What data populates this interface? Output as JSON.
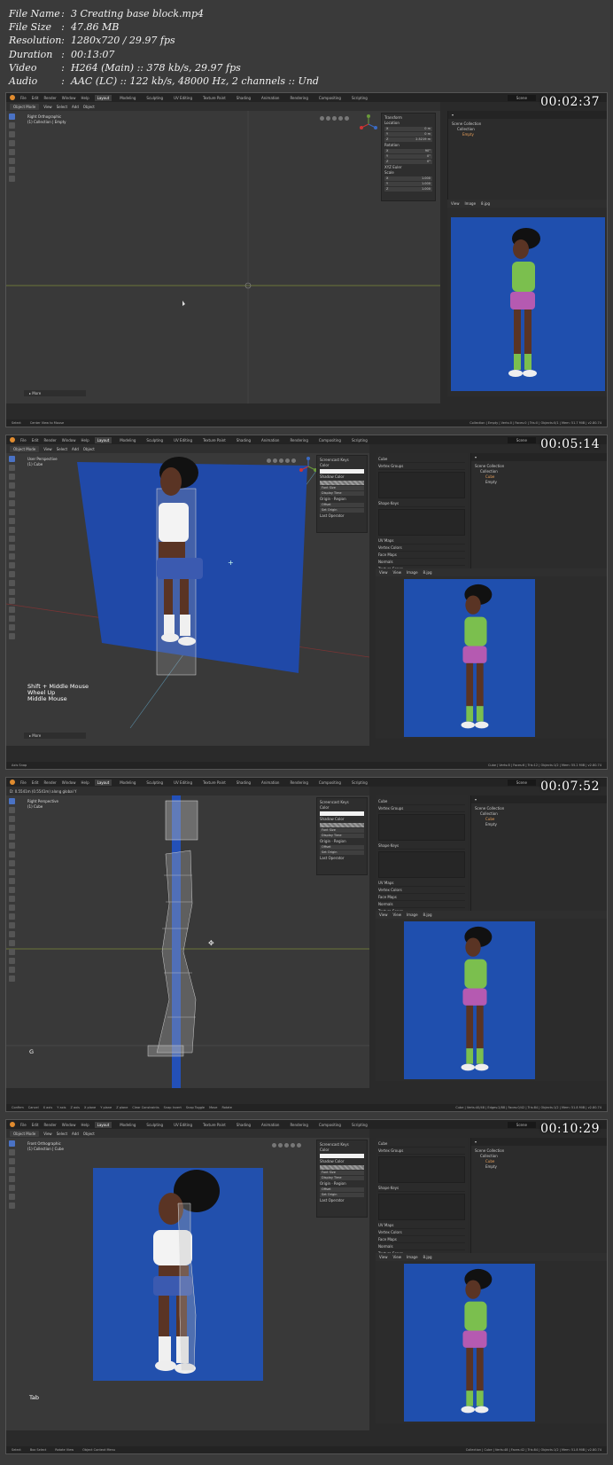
{
  "meta": [
    {
      "key": "File Name",
      "value": "3 Creating base block.mp4"
    },
    {
      "key": "File Size",
      "value": "47.86 MB"
    },
    {
      "key": "Resolution",
      "value": "1280x720 / 29.97 fps"
    },
    {
      "key": "Duration",
      "value": "00:13:07"
    },
    {
      "key": "Video",
      "value": "H264 (Main) :: 378 kb/s, 29.97 fps"
    },
    {
      "key": "Audio",
      "value": "AAC (LC) :: 122 kb/s, 48000 Hz, 2 channels :: Und"
    }
  ],
  "ui": {
    "menus": [
      "File",
      "Edit",
      "Render",
      "Window",
      "Help"
    ],
    "workspaces": [
      "Layout",
      "Modeling",
      "Sculpting",
      "UV Editing",
      "Texture Paint",
      "Shading",
      "Animation",
      "Rendering",
      "Compositing",
      "Scripting"
    ],
    "scene": "Scene",
    "view_menus": [
      "View",
      "Select",
      "Add",
      "Object"
    ],
    "edit_menus": [
      "View",
      "Select",
      "Add",
      "Mesh",
      "Vertex",
      "Edge",
      "Face",
      "UV"
    ],
    "image_menus": [
      "View",
      "View",
      "Image"
    ],
    "image_name": "8.jpg",
    "collection": "Scene Collection",
    "sub_collection": "Collection",
    "obj_cube": "Cube",
    "obj_empty": "Empty",
    "screencast": "Screencast Keys",
    "color_lbl": "Color",
    "shadow_lbl": "Shadow Color",
    "font_size": "Font Size",
    "display_time": "Display Time",
    "origin": "Origin",
    "region": "Region",
    "offset": "Offset",
    "set_origin": "Set Origin",
    "last_operator": "Last Operator",
    "vertex_groups": "Vertex Groups",
    "shape_keys": "Shape Keys",
    "uv_maps": "UV Maps",
    "vertex_colors": "Vertex Colors",
    "face_maps": "Face Maps",
    "normals": "Normals",
    "texture_space": "Texture Space",
    "transform": "Transform",
    "location": "Location",
    "rotation": "Rotation",
    "scale": "Scale",
    "xyz_euler": "XYZ Euler",
    "more": "More"
  },
  "frames": [
    {
      "timestamp": "00:02:37",
      "mode": "Object Mode",
      "view_label": "Right Orthographic",
      "view_sub": "(1) Collection | Empty",
      "status_left": "Select",
      "status_mid": "Center View to Mouse",
      "status_right": "Collection | Empty | Verts:0 | Faces:0 | Tris:0 | Objects:0/1 | Mem: 51.7 MiB | v2.80.74",
      "loc": [
        "0 m",
        "0 m",
        "2.5219 m"
      ],
      "rot": [
        "90°",
        "0°",
        "0°"
      ],
      "scl": [
        "1.000",
        "1.000",
        "1.000"
      ]
    },
    {
      "timestamp": "00:05:14",
      "mode": "Object Mode",
      "view_label": "User Perspective",
      "view_sub": "(1) Cube",
      "keys": [
        "Shift + Middle Mouse",
        "Wheel Up",
        "Middle Mouse"
      ],
      "status_left": "Axis Snap",
      "status_right": "Cube | Verts:8 | Faces:6 | Tris:12 | Objects:1/2 | Mem: 55.2 MiB | v2.80.74"
    },
    {
      "timestamp": "00:07:52",
      "mode": "Edit Mode",
      "view_label": "Right Perspective",
      "view_sub": "(1) Cube",
      "header_text": "D: 0.5541m (0.5541m) along global Y",
      "keys": [
        "G"
      ],
      "status_left": "Confirm",
      "status_items": [
        "Cancel",
        "X axis",
        "Y axis",
        "Z axis",
        "X plane",
        "Y plane",
        "Z plane",
        "Clear Constraints",
        "Snap Invert",
        "Snap Toggle",
        "Move",
        "Rotate"
      ],
      "status_right": "Cube | Verts:40/48 | Edges:2/88 | Faces:0/42 | Tris:84 | Objects:1/2 | Mem: 51.8 MiB | v2.80.74"
    },
    {
      "timestamp": "00:10:29",
      "mode": "Object Mode",
      "view_label": "Front Orthographic",
      "view_sub": "(1) Collection | Cube",
      "keys": [
        "Tab"
      ],
      "status_left": "Select",
      "status_mid": "Box Select",
      "status_mid2": "Rotate View",
      "status_mid3": "Object Context Menu",
      "status_right": "Collection | Cube | Verts:48 | Faces:42 | Tris:84 | Objects:1/2 | Mem: 51.8 MiB | v2.80.74"
    }
  ]
}
